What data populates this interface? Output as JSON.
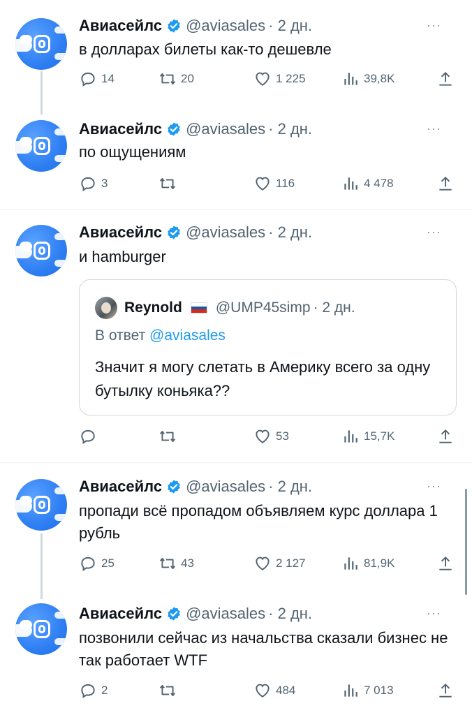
{
  "colors": {
    "accent": "#1d9bf0",
    "avatar_blue": "#2f7ff3",
    "secondary_text": "#536471"
  },
  "author": {
    "name": "Авиасейлс",
    "handle": "@aviasales",
    "time": "· 2 дн."
  },
  "more_label": "···",
  "tweets": [
    {
      "text": "в долларах билеты как-то дешевле",
      "replies": "14",
      "retweets": "20",
      "likes": "1 225",
      "views": "39,8K"
    },
    {
      "text": "по ощущениям",
      "replies": "3",
      "retweets": "",
      "likes": "116",
      "views": "4 478"
    },
    {
      "text": "и hamburger",
      "replies": "",
      "retweets": "",
      "likes": "53",
      "views": "15,7K",
      "quote": {
        "name": "Reynold",
        "handle": "@UMP45simp",
        "time": "· 2 дн.",
        "reply_prefix": "В ответ",
        "reply_to": "@aviasales",
        "text": "Значит я могу слетать в Америку всего за одну бутылку коньяка??"
      }
    },
    {
      "text": "пропади всё пропадом объявляем курс доллара 1 рубль",
      "replies": "25",
      "retweets": "43",
      "likes": "2 127",
      "views": "81,9K"
    },
    {
      "text": "позвонили сейчас из начальства сказали бизнес не так работает WTF",
      "replies": "2",
      "retweets": "",
      "likes": "484",
      "views": "7 013"
    }
  ]
}
